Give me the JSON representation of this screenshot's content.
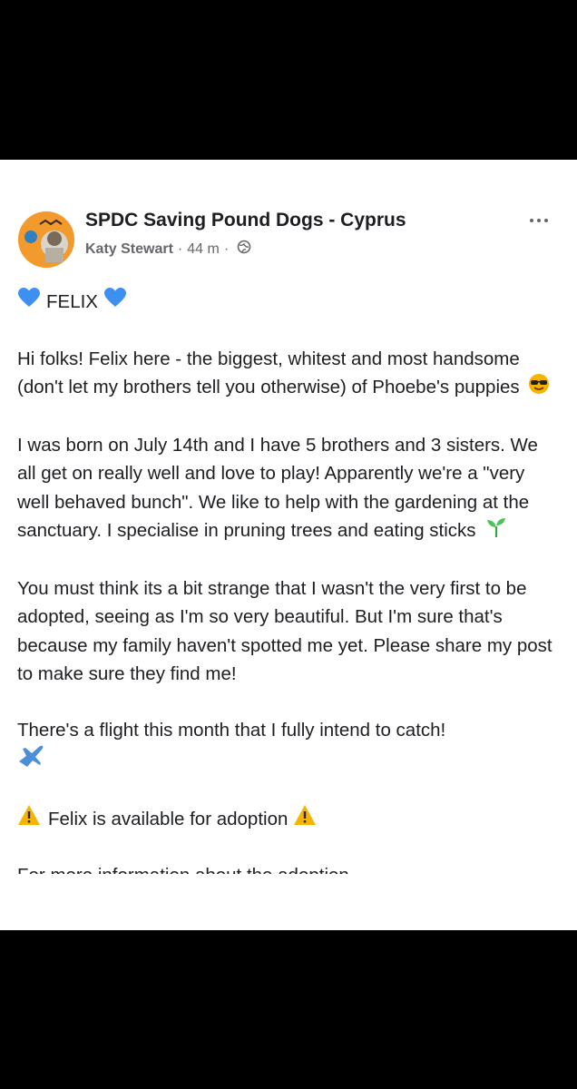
{
  "post": {
    "page_name": "SPDC Saving Pound Dogs - Cyprus",
    "author": "Katy Stewart",
    "separator": "·",
    "time": "44 m",
    "more_icon": "more-horizontal-icon",
    "privacy_icon": "globe-icon",
    "title": "FELIX",
    "title_icon": "blue-heart-icon",
    "paragraphs": {
      "p1": "Hi folks! Felix here - the biggest, whitest and most handsome (don't let my brothers tell you otherwise) of Phoebe's puppies",
      "p1_icon": "sunglasses-face-icon",
      "p2": "I was born on July 14th and I have 5 brothers and 3 sisters. We all get on really well and love to play! Apparently we're a \"very well behaved bunch\". We like to help with the gardening at the sanctuary. I specialise in pruning trees and eating sticks",
      "p2_icon": "seedling-icon",
      "p3": "You must think its a bit strange that I wasn't the very first to be adopted, seeing as I'm so very beautiful. But I'm sure that's because my family haven't spotted me yet. Please share my post to make sure they find me!",
      "p4": "There's a flight this month that I fully intend to catch!",
      "p4_icon": "airplane-icon",
      "p5": "Felix is available for adoption",
      "p5_icon": "warning-icon",
      "p6": "For more information about the adoption"
    },
    "colors": {
      "text": "#1c1e21",
      "secondary": "#65676b",
      "heart": "#3d8ff0",
      "warning": "#f5b400",
      "avatar_bg": "#f39a2c"
    }
  }
}
